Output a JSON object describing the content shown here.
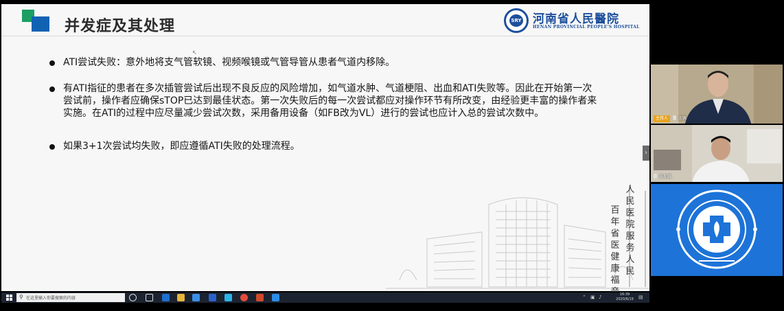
{
  "slide": {
    "title": "并发症及其处理",
    "logo": {
      "seal_text": "SRY",
      "name_cn": "河南省人民醫院",
      "name_en": "HENAN PROVINCIAL PEOPLE'S HOSPITAL"
    },
    "bullets": [
      "ATI尝试失败：意外地将支气管软镜、视频喉镜或气管导管从患者气道内移除。",
      "有ATI指征的患者在多次插管尝试后出现不良反应的风险增加，如气道水肿、气道梗阻、出血和ATI失败等。因此在开始第一次尝试前，操作者应确保sTOP已达到最佳状态。第一次失败后的每一次尝试都应对操作环节有所改变，由经验更丰富的操作者来实施。在ATI的过程中应尽量减少尝试次数，采用备用设备（如FB改为VL）进行的尝试也应计入总的尝试次数中。",
      "如果3+1次尝试均失败，即应遵循ATI失败的处理流程。"
    ],
    "calligraphy": {
      "col1": "人民医院服务人民",
      "col2": "百年省医健康福音"
    }
  },
  "taskbar": {
    "search_placeholder": "在这里输入你要搜索的内容",
    "time": "16:39",
    "date": "2020/6/19"
  },
  "participants": {
    "host_tag": "主持人",
    "video1_name": "王佩",
    "video2_name": "张加强"
  },
  "colors": {
    "accent_blue": "#1262b3",
    "accent_green": "#1a9e64",
    "logo_blue": "#1d4f9c",
    "host_tag": "#e8a31e",
    "tile_blue": "#1d73d8"
  }
}
